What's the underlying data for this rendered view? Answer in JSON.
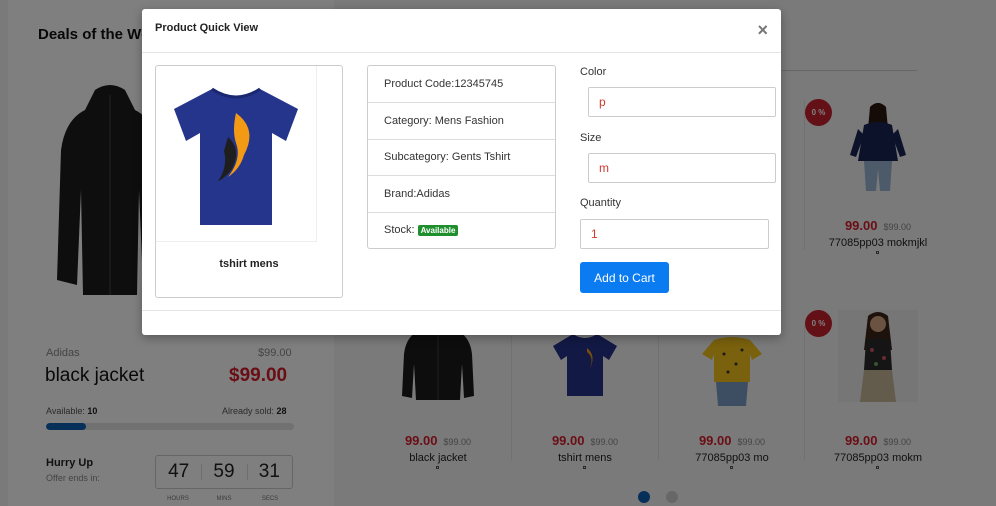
{
  "deal": {
    "section_title": "Deals of the Week",
    "brand": "Adidas",
    "old_price": "$99.00",
    "name": "black jacket",
    "price": "$99.00",
    "available_label": "Available:",
    "available_value": "10",
    "sold_label": "Already sold:",
    "sold_value": "28",
    "progress_fraction": 0.16,
    "hurry": "Hurry Up",
    "offer_ends": "Offer ends in:",
    "countdown": [
      {
        "value": "47",
        "unit": "HOURS"
      },
      {
        "value": "59",
        "unit": "MINS"
      },
      {
        "value": "31",
        "unit": "SECS"
      }
    ]
  },
  "products": [
    {
      "name": "77085pp03 mokmjkl",
      "price": "99.00",
      "old_price": "$99.00",
      "badge": "0 %",
      "icon": "woman-navy-top-image"
    },
    {
      "name": "black jacket",
      "price": "99.00",
      "old_price": "$99.00",
      "icon": "black-jacket-image"
    },
    {
      "name": "tshirt mens",
      "price": "99.00",
      "old_price": "$99.00",
      "icon": "blue-tshirt-image"
    },
    {
      "name": "77085pp03 mo",
      "price": "99.00",
      "old_price": "$99.00",
      "icon": "yellow-top-image"
    },
    {
      "name": "77085pp03 mokm",
      "price": "99.00",
      "old_price": "$99.00",
      "badge": "0 %",
      "icon": "woman-floral-top-image"
    }
  ],
  "carousel": {
    "active_color": "#0d5fb3",
    "inactive_color": "#cfcfcf"
  },
  "modal": {
    "title": "Product Quick View",
    "close": "×",
    "image_caption": "tshirt mens",
    "info": {
      "code": "Product Code:12345745",
      "category": "Category: Mens Fashion",
      "subcategory": "Subcategory: Gents Tshirt",
      "brand": "Brand:Adidas",
      "stock_label": "Stock:",
      "stock_badge": "Available"
    },
    "form": {
      "color_label": "Color",
      "color_value": "p",
      "size_label": "Size",
      "size_value": "m",
      "quantity_label": "Quantity",
      "quantity_value": "1",
      "add_to_cart": "Add to Cart"
    }
  },
  "colors": {
    "accent": "#0b7bf2",
    "price_red": "#d51d2a",
    "badge_red": "#c8202f",
    "stock_green": "#1f8f2d"
  }
}
